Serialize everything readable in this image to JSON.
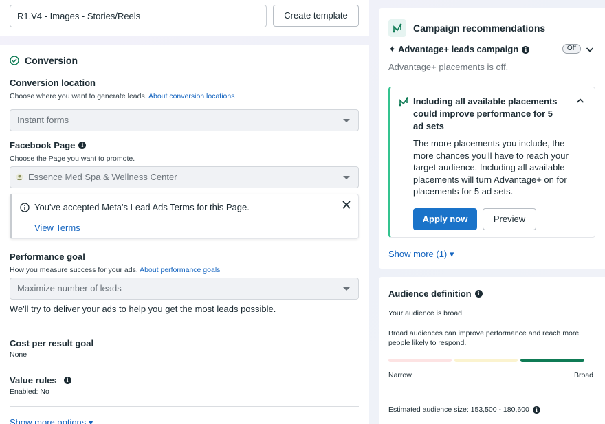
{
  "left": {
    "ad_name_value": "R1.V4 - Images - Stories/Reels",
    "create_template_label": "Create template",
    "conversion": {
      "title": "Conversion",
      "location_label": "Conversion location",
      "location_help": "Choose where you want to generate leads.",
      "location_link": "About conversion locations",
      "location_value": "Instant forms",
      "page_label": "Facebook Page",
      "page_help": "Choose the Page you want to promote.",
      "page_value": "Essence Med Spa & Wellness Center",
      "notice_text": "You've accepted Meta's Lead Ads Terms for this Page.",
      "notice_link": "View Terms",
      "goal_label": "Performance goal",
      "goal_help": "How you measure success for your ads.",
      "goal_link": "About performance goals",
      "goal_value": "Maximize number of leads",
      "goal_desc": "We'll try to deliver your ads to help you get the most leads possible.",
      "cost_label": "Cost per result goal",
      "cost_value": "None",
      "value_rules_label": "Value rules",
      "value_rules_value": "Enabled: No",
      "show_more_options": "Show more options ▾"
    }
  },
  "right": {
    "recommendations": {
      "title": "Campaign recommendations",
      "advantage_label": "✦ Advantage+ leads campaign",
      "toggle_label": "Off",
      "advantage_sub": "Advantage+ placements is off.",
      "card_title": "Including all available placements could improve performance for 5 ad sets",
      "card_body": "The more placements you include, the more chances you'll have to reach your target audience. Including all available placements will turn Advantage+ on for placements for 5 ad sets.",
      "apply_label": "Apply now",
      "preview_label": "Preview",
      "show_more": "Show more (1) ▾"
    },
    "audience": {
      "title": "Audience definition",
      "status": "Your audience is broad.",
      "desc": "Broad audiences can improve performance and reach more people likely to respond.",
      "narrow_label": "Narrow",
      "broad_label": "Broad",
      "estimate": "Estimated audience size: 153,500 - 180,600"
    }
  },
  "colors": {
    "link": "#1565c0",
    "primary_button": "#1a73c9",
    "accent_green": "#34c38f",
    "bar_red": "#fde3e3",
    "bar_yellow": "#fbf3cf",
    "bar_green": "#0f7b55"
  }
}
